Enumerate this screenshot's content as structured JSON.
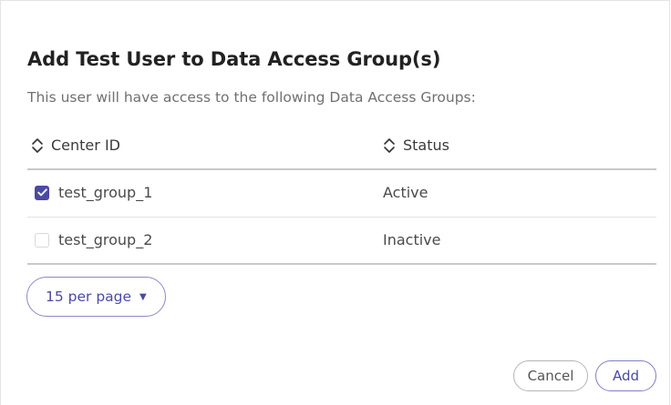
{
  "dialog": {
    "title": "Add Test User to Data Access Group(s)",
    "subtitle": "This user will have access to the following Data Access Groups:"
  },
  "table": {
    "columns": [
      {
        "label": "Center ID",
        "icon": "sort-icon"
      },
      {
        "label": "Status",
        "icon": "sort-icon"
      }
    ],
    "rows": [
      {
        "center_id": "test_group_1",
        "status": "Active",
        "checked": true
      },
      {
        "center_id": "test_group_2",
        "status": "Inactive",
        "checked": false
      }
    ]
  },
  "pagination": {
    "per_page_label": "15 per page",
    "caret_icon": "caret-down-icon"
  },
  "actions": {
    "cancel_label": "Cancel",
    "add_label": "Add"
  },
  "colors": {
    "accent": "#4b4aa3",
    "text": "#333333",
    "muted": "#707070",
    "border": "#c9c9c9"
  }
}
